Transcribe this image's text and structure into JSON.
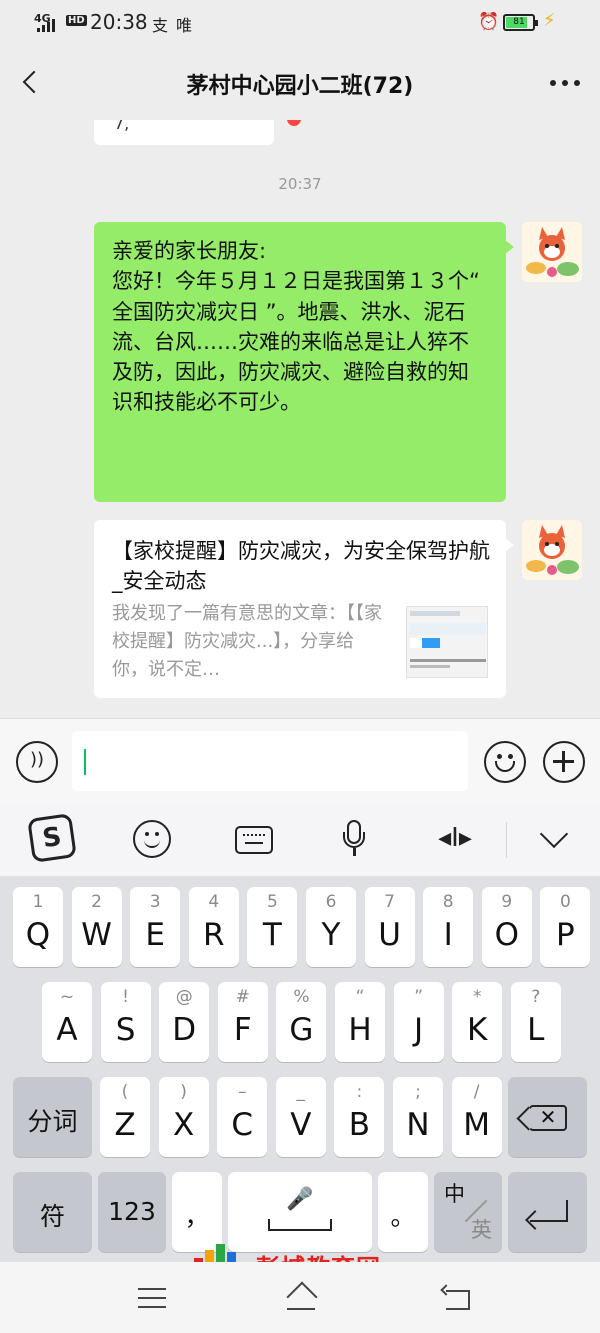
{
  "status_bar": {
    "network": "4G",
    "hd": "HD",
    "time": "20:38",
    "app_icons": [
      "支",
      "唯"
    ],
    "battery": "81",
    "battery_level": 0.81
  },
  "header": {
    "title": "茅村中心园小二班(72)"
  },
  "chat": {
    "previous_fragment": "7,",
    "timestamp": "20:37",
    "messages": [
      {
        "type": "text",
        "text": "亲爱的家长朋友:\n您好！今年５月１２日是我国第１３个“ 全国防灾减灾日 ”。地震、洪水、泥石流、台风……灾难的来临总是让人猝不及防，因此，防灾减灾、避险自救的知识和技能必不可少。"
      },
      {
        "type": "link_card",
        "title": "【家校提醒】防灾减灾，为安全保驾护航_安全动态",
        "description": "我发现了一篇有意思的文章：【【家校提醒】防灾减灾...】，分享给你，说不定…",
        "thumbnail_icon": "article-thumbnail"
      }
    ]
  },
  "toolbar": {
    "sogou_label": "S",
    "cursor_label": "◂I▸"
  },
  "keyboard": {
    "row1": [
      {
        "main": "Q",
        "hint": "1"
      },
      {
        "main": "W",
        "hint": "2"
      },
      {
        "main": "E",
        "hint": "3"
      },
      {
        "main": "R",
        "hint": "4"
      },
      {
        "main": "T",
        "hint": "5"
      },
      {
        "main": "Y",
        "hint": "6"
      },
      {
        "main": "U",
        "hint": "7"
      },
      {
        "main": "I",
        "hint": "8"
      },
      {
        "main": "O",
        "hint": "9"
      },
      {
        "main": "P",
        "hint": "0"
      }
    ],
    "row2": [
      {
        "main": "A",
        "hint": "~"
      },
      {
        "main": "S",
        "hint": "!"
      },
      {
        "main": "D",
        "hint": "@"
      },
      {
        "main": "F",
        "hint": "#"
      },
      {
        "main": "G",
        "hint": "%"
      },
      {
        "main": "H",
        "hint": "“"
      },
      {
        "main": "J",
        "hint": "”"
      },
      {
        "main": "K",
        "hint": "*"
      },
      {
        "main": "L",
        "hint": "?"
      }
    ],
    "row3_left": "分词",
    "row3": [
      {
        "main": "Z",
        "hint": "("
      },
      {
        "main": "X",
        "hint": ")"
      },
      {
        "main": "C",
        "hint": "–"
      },
      {
        "main": "V",
        "hint": "_"
      },
      {
        "main": "B",
        "hint": ":"
      },
      {
        "main": "N",
        "hint": ";"
      },
      {
        "main": "M",
        "hint": "/"
      }
    ],
    "row4": {
      "symbol": "符",
      "numbers": "123",
      "comma": "，",
      "period": "。",
      "lang_primary": "中",
      "lang_secondary": "英"
    }
  },
  "watermark": {
    "text": "彭城教育网"
  },
  "colors": {
    "sent_bubble": "#95ec69",
    "cursor": "#07c160",
    "watermark": "#e0231f"
  }
}
